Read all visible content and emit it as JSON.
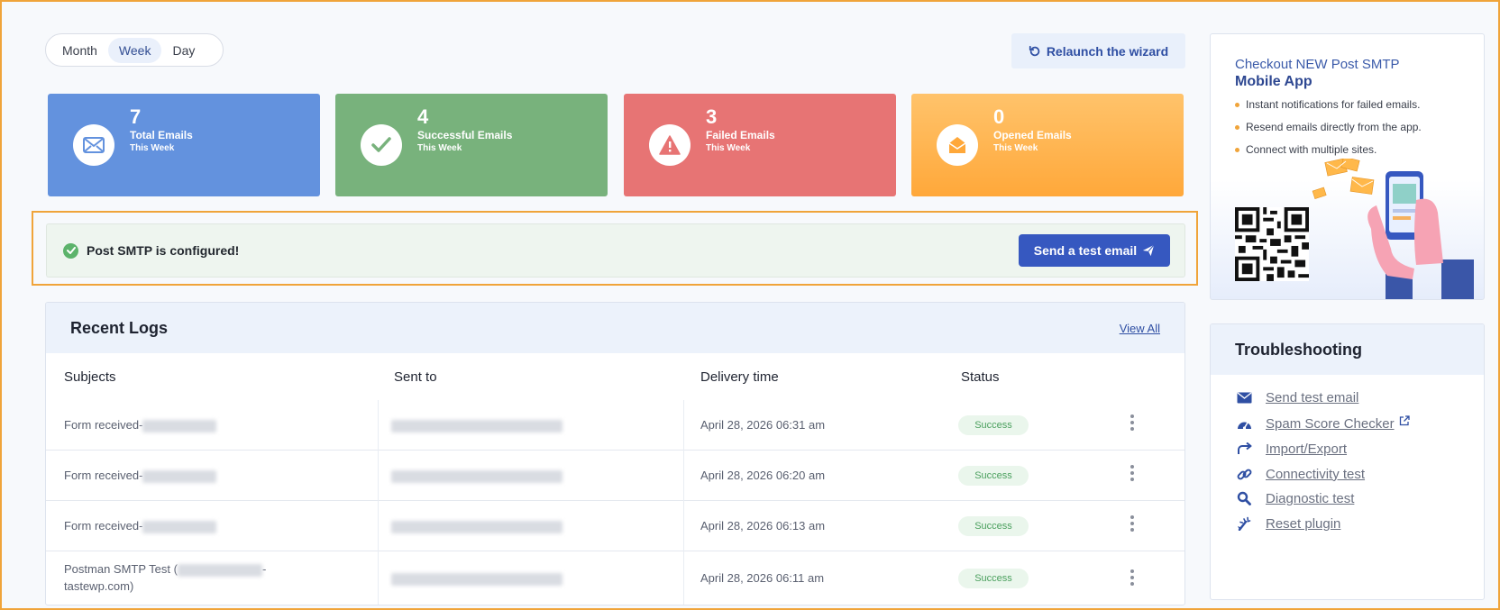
{
  "period": {
    "options": [
      "Month",
      "Week",
      "Day"
    ],
    "selected": "Week"
  },
  "relaunch": {
    "label": "Relaunch the wizard"
  },
  "stats": [
    {
      "value": "7",
      "label": "Total Emails",
      "sub": "This Week",
      "icon": "mail-icon",
      "color": "#6392de"
    },
    {
      "value": "4",
      "label": "Successful Emails",
      "sub": "This Week",
      "icon": "check-icon",
      "color": "#78b27c"
    },
    {
      "value": "3",
      "label": "Failed Emails",
      "sub": "This Week",
      "icon": "warning-icon",
      "color": "#e77474"
    },
    {
      "value": "0",
      "label": "Opened Emails",
      "sub": "This Week",
      "icon": "open-mail-icon",
      "color": "#ffa83a"
    }
  ],
  "config": {
    "message": "Post SMTP is configured!",
    "button": "Send a test email"
  },
  "logs": {
    "title": "Recent Logs",
    "view_all": "View All",
    "columns": [
      "Subjects",
      "Sent to",
      "Delivery time",
      "Status"
    ],
    "rows": [
      {
        "subject": "Form received-",
        "time": "April 28, 2026 06:31 am",
        "status": "Success"
      },
      {
        "subject": "Form received-",
        "time": "April 28, 2026 06:20 am",
        "status": "Success"
      },
      {
        "subject": "Form received-",
        "time": "April 28, 2026 06:13 am",
        "status": "Success"
      },
      {
        "subject": "Postman SMTP Test (",
        "subject_tail": "-",
        "subject_line2": "tastewp.com)",
        "time": "April 28, 2026 06:11 am",
        "status": "Success"
      }
    ]
  },
  "promo": {
    "title": "Checkout NEW Post SMTP",
    "title_bold": "Mobile App",
    "bullets": [
      "Instant notifications for failed emails.",
      "Resend emails directly from the app.",
      "Connect with multiple sites."
    ]
  },
  "troubleshooting": {
    "title": "Troubleshooting",
    "items": [
      {
        "label": "Send test email",
        "icon": "mail-icon"
      },
      {
        "label": "Spam Score Checker",
        "icon": "gauge-icon"
      },
      {
        "label": "Import/Export",
        "icon": "share-icon"
      },
      {
        "label": "Connectivity test",
        "icon": "link-icon"
      },
      {
        "label": "Diagnostic test",
        "icon": "search-icon"
      },
      {
        "label": "Reset plugin",
        "icon": "reset-icon"
      }
    ]
  }
}
